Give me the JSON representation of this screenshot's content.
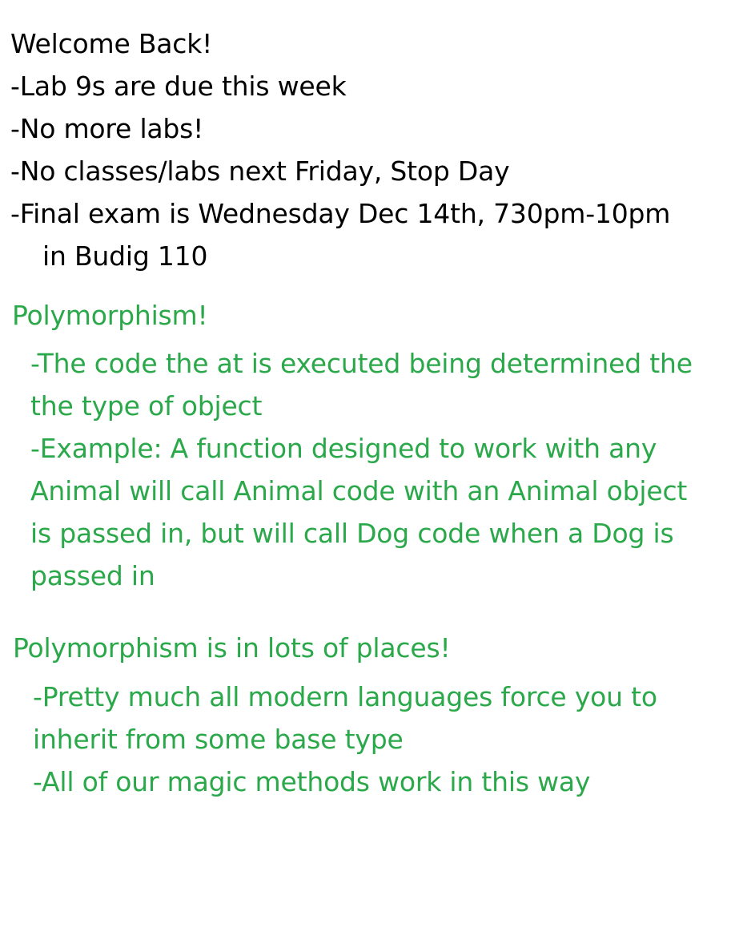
{
  "announcements": {
    "lines": [
      "Welcome Back!",
      "-Lab 9s are due this week",
      "-No more labs!",
      "-No classes/labs next Friday, Stop Day",
      "-Final exam is Wednesday Dec 14th, 730pm-10pm",
      "in Budig 110"
    ]
  },
  "polymorphism": {
    "heading": "Polymorphism!",
    "lines": [
      "-The code the at is executed being determined the",
      "the type of object",
      "-Example: A function designed to work with any",
      "Animal will call Animal code with an Animal object",
      "is passed in, but will call Dog code when a Dog is",
      "passed in"
    ]
  },
  "places": {
    "heading": "Polymorphism is in lots of places!",
    "lines": [
      "-Pretty much all modern languages force you to",
      "inherit from some base type",
      "-All of our magic methods work in this way"
    ]
  },
  "colors": {
    "text_black": "#000000",
    "text_green": "#2aa84a"
  }
}
